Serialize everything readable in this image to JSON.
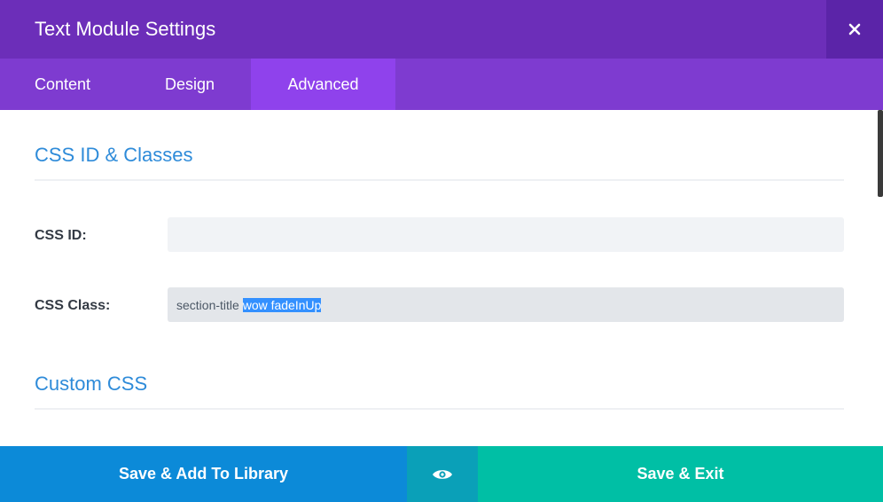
{
  "modal": {
    "title": "Text Module Settings"
  },
  "icons": {
    "close": "close-icon",
    "preview": "eye-icon"
  },
  "tabs": [
    {
      "label": "Content",
      "active": false
    },
    {
      "label": "Design",
      "active": false
    },
    {
      "label": "Advanced",
      "active": true
    }
  ],
  "sections": {
    "css_id_classes": {
      "title": "CSS ID & Classes",
      "css_id": {
        "label": "CSS ID:",
        "value": ""
      },
      "css_class": {
        "label": "CSS Class:",
        "value_prefix": "section-title ",
        "value_selected": "wow fadeInUp"
      }
    },
    "custom_css": {
      "title": "Custom CSS"
    }
  },
  "footer": {
    "save_library_label": "Save & Add To Library",
    "save_exit_label": "Save & Exit"
  },
  "colors": {
    "header": "#6c2eb9",
    "tab_bar": "#7e3bd0",
    "active_tab": "#8f42ec",
    "section_title": "#2e8bd9",
    "save_library": "#0c8ad8",
    "preview": "#0aa0b8",
    "save_exit": "#00bfa5"
  }
}
